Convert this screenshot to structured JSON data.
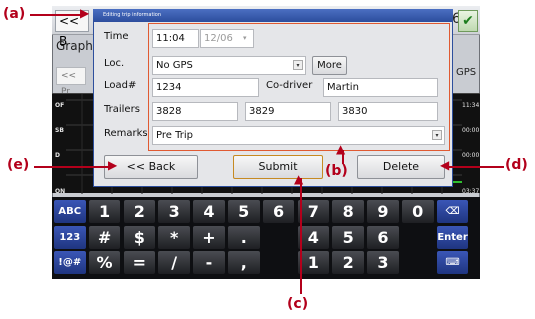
{
  "annotations": {
    "a": "(a)",
    "b": "(b)",
    "c": "(c)",
    "d": "(d)",
    "e": "(e)"
  },
  "background": {
    "hidden_button": "<< B",
    "hidden_number": "6",
    "check_icon": "check-icon",
    "graph_tab": "Graph",
    "prev_button": "<< Pr",
    "gps_label": "GPS",
    "duty_rows": [
      "OF",
      "SB",
      "D",
      "ON"
    ],
    "times": [
      "11:34",
      "00:00",
      "00:00",
      "03:37"
    ]
  },
  "dialog": {
    "title": "Editing trip information",
    "fields": {
      "time_label": "Time",
      "time_value": "11:04",
      "date_value": "12/06",
      "loc_label": "Loc.",
      "loc_value": "No GPS",
      "more_label": "More",
      "load_label": "Load#",
      "load_value": "1234",
      "codriver_label": "Co-driver",
      "codriver_value": "Martin",
      "trailers_label": "Trailers",
      "trailer1": "3828",
      "trailer2": "3829",
      "trailer3": "3830",
      "remarks_label": "Remarks",
      "remarks_value": "Pre Trip"
    },
    "buttons": {
      "back": "<< Back",
      "submit": "Submit",
      "delete": "Delete"
    }
  },
  "keyboard": {
    "row1": [
      "ABC",
      "1",
      "2",
      "3",
      "4",
      "5",
      "6",
      "7",
      "8",
      "9",
      "0",
      "⌫"
    ],
    "row2": [
      "123",
      "#",
      "$",
      "*",
      "+",
      ".",
      "",
      "4",
      "5",
      "6",
      "",
      "Enter"
    ],
    "row3": [
      "!@#",
      "%",
      "=",
      "/",
      "-",
      ",",
      "",
      "1",
      "2",
      "3",
      "",
      "⌨"
    ]
  },
  "colors": {
    "annotation": "#b3001b",
    "highlight_box": "#e05a32",
    "dialog_title": "#2c4d9d"
  }
}
